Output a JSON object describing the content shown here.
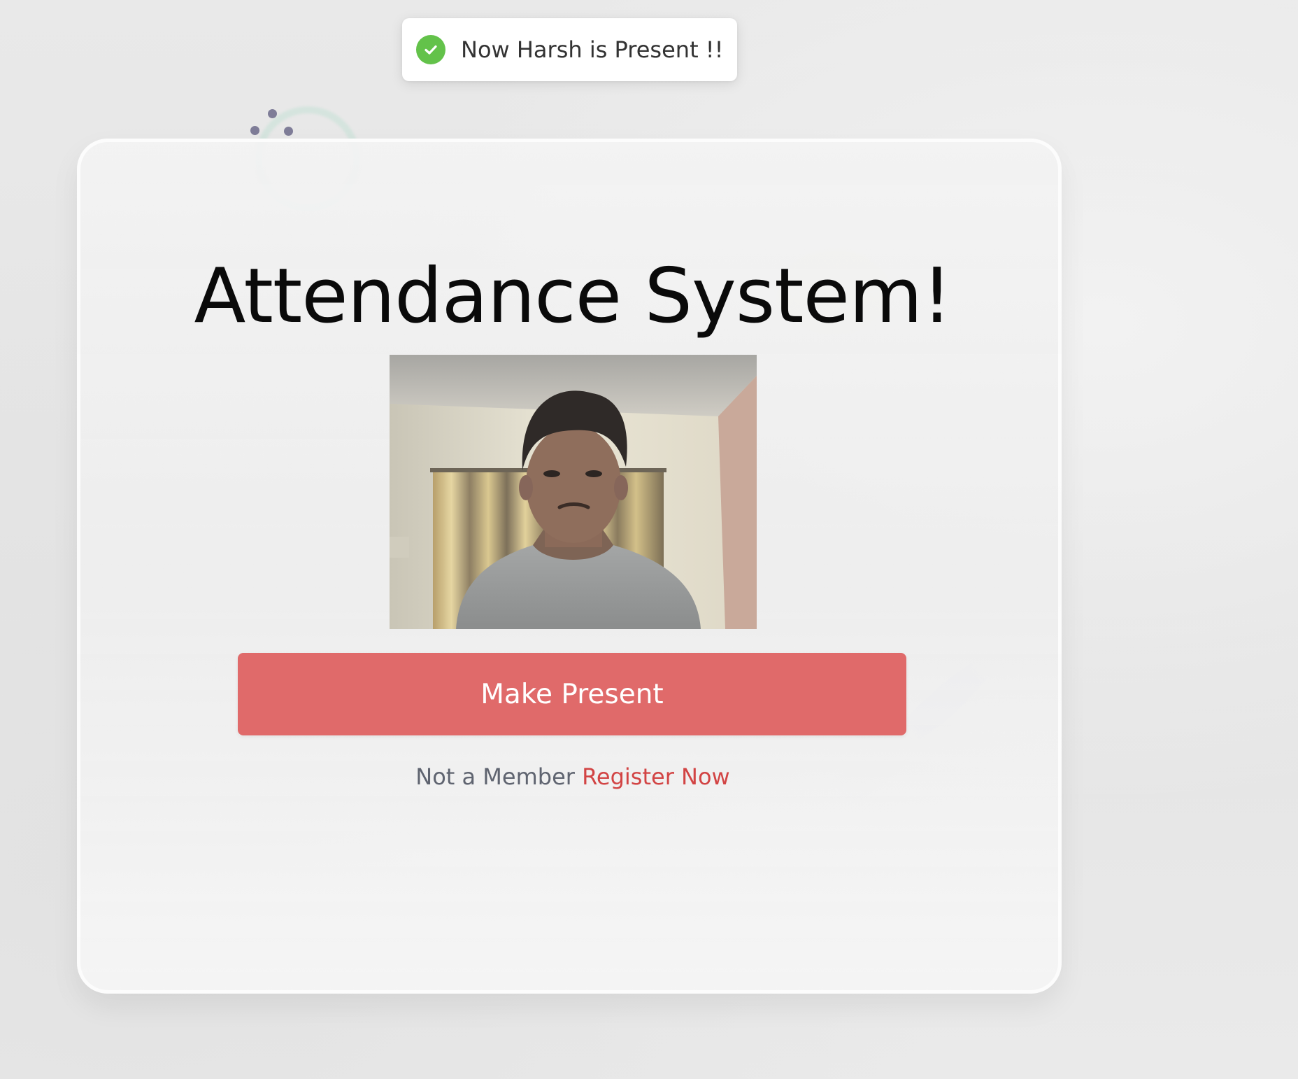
{
  "toast": {
    "message": "Now Harsh is Present !!",
    "icon": "check-circle-icon",
    "icon_color": "#63c24a"
  },
  "page": {
    "title": "Attendance System!"
  },
  "webcam": {
    "alt": "Live webcam feed"
  },
  "actions": {
    "make_present_label": "Make Present",
    "button_color": "#e06a6a"
  },
  "register": {
    "prompt": "Not a Member",
    "link_label": "Register Now",
    "link_color": "#d24444"
  }
}
